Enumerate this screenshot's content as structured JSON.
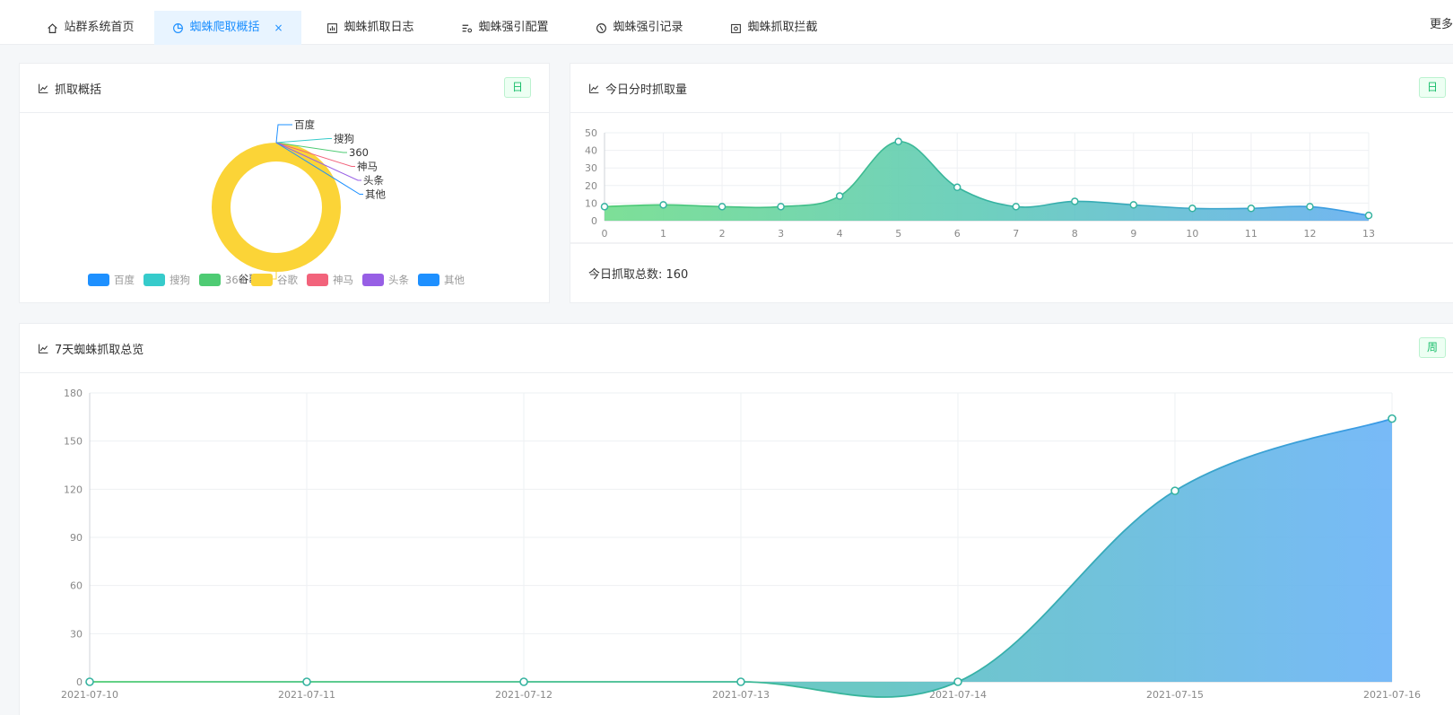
{
  "tabs": [
    {
      "label": "站群系统首页",
      "icon": "home-icon"
    },
    {
      "label": "蜘蛛爬取概括",
      "icon": "pie-chart-icon",
      "active": true
    },
    {
      "label": "蜘蛛抓取日志",
      "icon": "bar-chart-icon"
    },
    {
      "label": "蜘蛛强引配置",
      "icon": "settings-list-icon"
    },
    {
      "label": "蜘蛛强引记录",
      "icon": "clock-icon"
    },
    {
      "label": "蜘蛛抓取拦截",
      "icon": "photo-icon"
    }
  ],
  "close_symbol": "×",
  "more_label": "更多",
  "cards": {
    "crawl_overview": {
      "title": "抓取概括",
      "badge": "日"
    },
    "hourly": {
      "title": "今日分时抓取量",
      "badge": "日",
      "total_label": "今日抓取总数: 160"
    },
    "weekly": {
      "title": "7天蜘蛛抓取总览",
      "badge": "周"
    }
  },
  "colors": {
    "accent": "#1e90ff",
    "baidu": "#1e90ff",
    "sogou": "#36cbcb",
    "s360": "#4ecb73",
    "google": "#fbd437",
    "shenma": "#f2637b",
    "toutiao": "#975fe5",
    "other": "#1e90ff",
    "badge_green": "#19be6b"
  },
  "chart_data": [
    {
      "type": "pie",
      "variant": "donut",
      "labels": [
        "百度",
        "搜狗",
        "360",
        "谷歌",
        "神马",
        "头条",
        "其他"
      ],
      "values": [
        0,
        0,
        0,
        160,
        0,
        0,
        0
      ],
      "legend": [
        "百度",
        "搜狗",
        "360",
        "谷歌",
        "神马",
        "头条",
        "其他"
      ],
      "legend_position": "bottom"
    },
    {
      "type": "area",
      "x": [
        0,
        1,
        2,
        3,
        4,
        5,
        6,
        7,
        8,
        9,
        10,
        11,
        12,
        13
      ],
      "values": [
        8,
        9,
        8,
        8,
        14,
        45,
        19,
        8,
        11,
        9,
        7,
        7,
        8,
        3
      ],
      "xticks": [
        "0",
        "1",
        "2",
        "3",
        "4",
        "5",
        "6",
        "7",
        "8",
        "9",
        "10",
        "11",
        "12",
        "13"
      ],
      "yticks": [
        "0",
        "10",
        "20",
        "30",
        "40",
        "50"
      ],
      "ylim": [
        0,
        50
      ],
      "grid": true
    },
    {
      "type": "area",
      "x": [
        "2021-07-10",
        "2021-07-11",
        "2021-07-12",
        "2021-07-13",
        "2021-07-14",
        "2021-07-15",
        "2021-07-16"
      ],
      "values": [
        0,
        0,
        0,
        0,
        0,
        119,
        164
      ],
      "yticks": [
        "0",
        "30",
        "60",
        "90",
        "120",
        "150",
        "180"
      ],
      "ylim": [
        0,
        180
      ],
      "grid": true
    }
  ]
}
